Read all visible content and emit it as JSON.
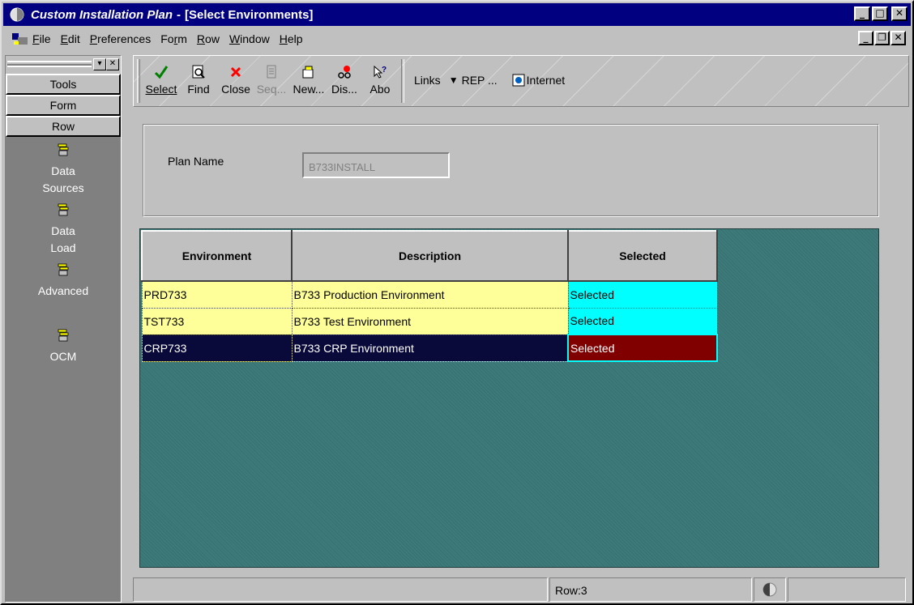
{
  "window": {
    "app_title": "Custom Installation Plan",
    "separator": "-",
    "form_title": "[Select Environments]"
  },
  "menubar": {
    "items": [
      "File",
      "Edit",
      "Preferences",
      "Form",
      "Row",
      "Window",
      "Help"
    ]
  },
  "left_panel": {
    "tabs": [
      "Tools",
      "Form",
      "Row"
    ],
    "items": [
      {
        "line1": "Data",
        "line2": "Sources",
        "icon": "exit-icon"
      },
      {
        "line1": "Data",
        "line2": "Load",
        "icon": "exit-icon"
      },
      {
        "line1": "Advanced",
        "line2": "",
        "icon": "exit-icon"
      },
      {
        "line1": "OCM",
        "line2": "",
        "icon": "exit-icon"
      }
    ]
  },
  "toolbar": {
    "buttons": [
      {
        "label": "Select",
        "icon": "check-icon",
        "color": "#008000"
      },
      {
        "label": "Find",
        "icon": "find-icon"
      },
      {
        "label": "Close",
        "icon": "close-x-icon",
        "color": "#ff0000"
      },
      {
        "label": "Seq...",
        "icon": "sequence-icon",
        "disabled": true
      },
      {
        "label": "New...",
        "icon": "new-folder-icon"
      },
      {
        "label": "Dis...",
        "icon": "display-icon"
      },
      {
        "label": "Abo",
        "icon": "help-about-icon"
      }
    ],
    "links_label": "Links",
    "rep_label": "REP ...",
    "internet_label": "Internet"
  },
  "header": {
    "plan_name_label": "Plan Name",
    "plan_name_value": "B733INSTALL"
  },
  "grid": {
    "columns": [
      "Environment",
      "Description",
      "Selected"
    ],
    "rows": [
      {
        "environment": "PRD733",
        "description": "B733 Production Environment",
        "selected": "Selected"
      },
      {
        "environment": "TST733",
        "description": "B733 Test Environment",
        "selected": "Selected"
      },
      {
        "environment": "CRP733",
        "description": "B733 CRP Environment",
        "selected": "Selected"
      }
    ]
  },
  "statusbar": {
    "row_text": "Row:3"
  },
  "colors": {
    "title_bar": "#000080",
    "grid_background": "#3d7a7a",
    "row_yellow": "#ffff99",
    "selected_cyan": "#00ffff",
    "current_row": "#0a0a3a",
    "current_selected": "#800000"
  }
}
